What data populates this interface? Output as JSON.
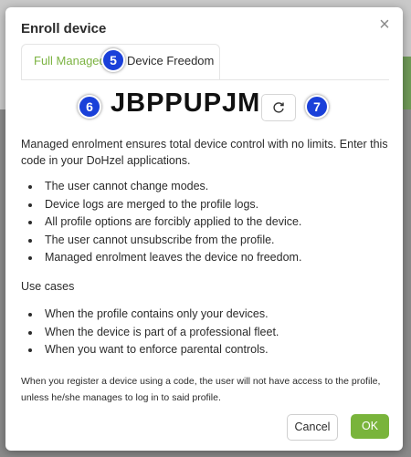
{
  "dialog": {
    "title": "Enroll device",
    "close_glyph": "×",
    "tabs": [
      {
        "label": "Full Managed",
        "active": true
      },
      {
        "label": "Device Freedom",
        "active": false
      }
    ],
    "code": "JBPPUPJM",
    "refresh_icon": "refresh-icon",
    "intro": "Managed enrolment ensures total device control with no limits. Enter this code in your DoHzel applications.",
    "features": [
      "The user cannot change modes.",
      "Device logs are merged to the profile logs.",
      "All profile options are forcibly applied to the device.",
      "The user cannot unsubscribe from the profile.",
      "Managed enrolment leaves the device no freedom."
    ],
    "use_cases_heading": "Use cases",
    "use_cases": [
      "When the profile contains only your devices.",
      "When the device is part of a professional fleet.",
      "When you want to enforce parental controls."
    ],
    "note": "When you register a device using a code, the user will not have access to the profile, unless he/she manages to log in to said profile.",
    "cancel_label": "Cancel",
    "ok_label": "OK"
  },
  "annotations": {
    "badge_5": "5",
    "badge_6": "6",
    "badge_7": "7"
  },
  "colors": {
    "accent": "#79b43b",
    "badge": "#1a40d9"
  }
}
